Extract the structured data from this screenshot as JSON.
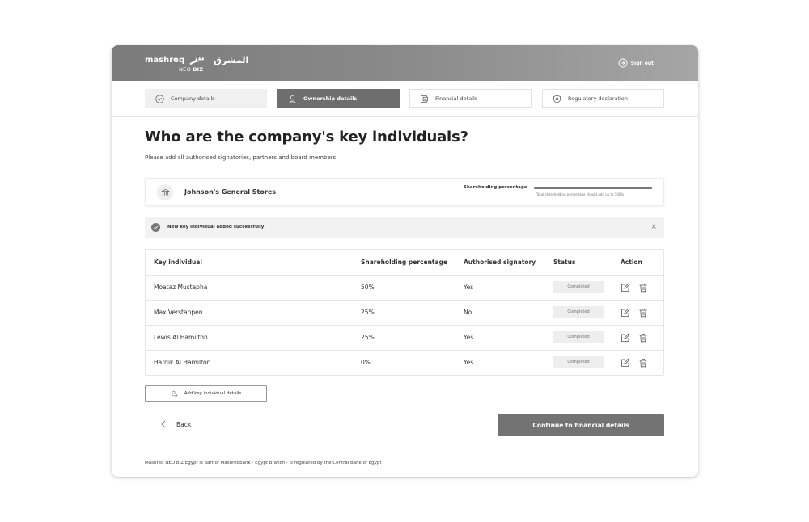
{
  "header": {
    "brand_en": "mashreq",
    "brand_ar": "المشرق",
    "product_neo": "NEO",
    "product_biz": "BIZ",
    "signout_label": "Sign out"
  },
  "steps": [
    {
      "label": "Company details",
      "state": "done"
    },
    {
      "label": "Ownership details",
      "state": "active"
    },
    {
      "label": "Financial details",
      "state": "pending"
    },
    {
      "label": "Regulatory declaration",
      "state": "pending"
    }
  ],
  "page": {
    "title": "Who are the company's key individuals?",
    "subtitle": "Please add all authorised signatories, partners and board members"
  },
  "company": {
    "name": "Johnson's General Stores",
    "shareholding_label": "Shareholding percentage",
    "shareholding_total_percent": 100,
    "shareholding_note": "Total shareholding percentage should add up to 100%"
  },
  "toast": {
    "message": "New key individual added successfully",
    "close": "×"
  },
  "table": {
    "headers": [
      "Key individual",
      "Shareholding percentage",
      "Authorised signatory",
      "Status",
      "Action"
    ],
    "rows": [
      {
        "name": "Moataz Mustapha",
        "share": "50%",
        "signatory": "Yes",
        "status": "Completed"
      },
      {
        "name": "Max Verstappen",
        "share": "25%",
        "signatory": "No",
        "status": "Completed"
      },
      {
        "name": "Lewis Al Hamilton",
        "share": "25%",
        "signatory": "Yes",
        "status": "Completed"
      },
      {
        "name": "Hardik Al Hamilton",
        "share": "0%",
        "signatory": "Yes",
        "status": "Completed"
      }
    ]
  },
  "actions": {
    "add_label": "Add key individual details",
    "back_label": "Back",
    "continue_label": "Continue to financial details"
  },
  "footer": {
    "text": "Mashreq NEO BIZ Egypt is part of Mashreqbank - Egypt Branch - is regulated by the Central Bank of Egypt"
  },
  "colors": {
    "header_start": "#7b7b7b",
    "header_end": "#a6a6a6",
    "active_step": "#6e6e6e",
    "primary_button": "#737373",
    "badge_bg": "#eeeeee"
  }
}
